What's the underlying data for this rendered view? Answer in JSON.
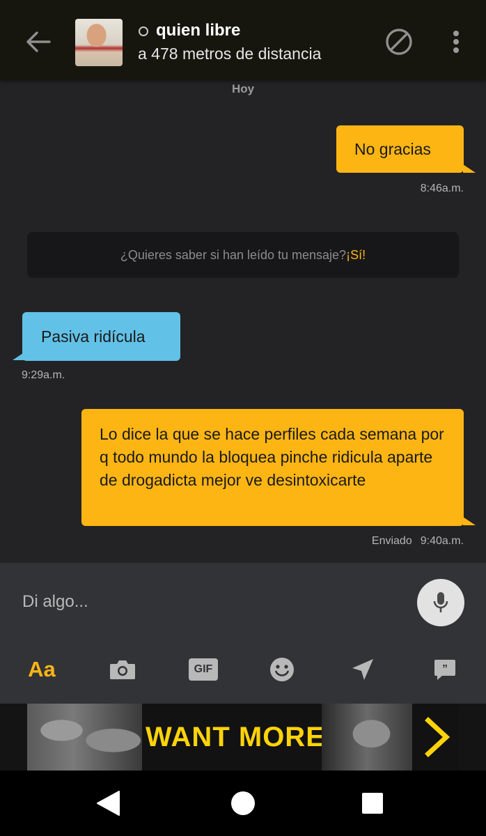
{
  "header": {
    "contact_name": "quien libre",
    "contact_distance": "a 478 metros de distancia",
    "status": "offline"
  },
  "conversation": {
    "date_label": "Hoy",
    "messages": [
      {
        "direction": "sent",
        "text": "No gracias",
        "time": "8:46a.m."
      },
      {
        "direction": "received",
        "text": "Pasiva ridícula",
        "time": "9:29a.m."
      },
      {
        "direction": "sent",
        "text": "Lo dice la que se hace perfiles cada semana por q todo mundo la bloquea pinche ridicula aparte de drogadicta mejor ve desintoxicarte",
        "status": "Enviado",
        "time": "9:40a.m."
      }
    ],
    "read_receipt_prompt": {
      "question": "¿Quieres saber si han leído tu mensaje?",
      "action": "¡Sí!"
    }
  },
  "composer": {
    "placeholder": "Di algo...",
    "text_tool_label": "Aa",
    "gif_label": "GIF",
    "tools": [
      "text-format-icon",
      "camera-icon",
      "gif-icon",
      "smiley-icon",
      "location-arrow-icon",
      "saved-phrases-icon"
    ]
  },
  "ad": {
    "text": "WANT MORE?"
  },
  "colors": {
    "accent": "#fdb514",
    "sent_bubble": "#fdb514",
    "received_bubble": "#62c1e7",
    "background": "#232326",
    "header": "#16160f"
  }
}
